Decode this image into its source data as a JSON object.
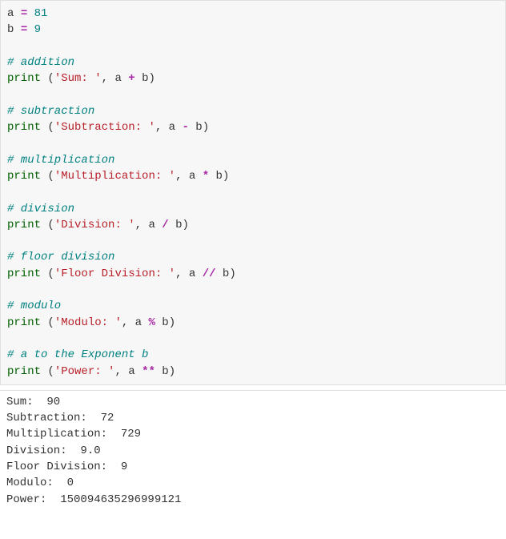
{
  "code": {
    "a_name": "a",
    "eq1": "=",
    "a_val": "81",
    "b_name": "b",
    "eq2": "=",
    "b_val": "9",
    "c_add": "# addition",
    "print1": "print",
    "lp1": "(",
    "s1": "'Sum: '",
    "cm1": ",",
    "a1": "a",
    "op1": "+",
    "b1": "b",
    "rp1": ")",
    "c_sub": "# subtraction",
    "print2": "print",
    "lp2": "(",
    "s2": "'Subtraction: '",
    "cm2": ",",
    "a2": "a",
    "op2": "-",
    "b2": "b",
    "rp2": ")",
    "c_mul": "# multiplication",
    "print3": "print",
    "lp3": "(",
    "s3": "'Multiplication: '",
    "cm3": ",",
    "a3": "a",
    "op3": "*",
    "b3": "b",
    "rp3": ")",
    "c_div": "# division",
    "print4": "print",
    "lp4": "(",
    "s4": "'Division: '",
    "cm4": ",",
    "a4": "a",
    "op4": "/",
    "b4": "b",
    "rp4": ")",
    "c_fdiv": "# floor division",
    "print5": "print",
    "lp5": "(",
    "s5": "'Floor Division: '",
    "cm5": ",",
    "a5": "a",
    "op5": "//",
    "b5": "b",
    "rp5": ")",
    "c_mod": "# modulo",
    "print6": "print",
    "lp6": "(",
    "s6": "'Modulo: '",
    "cm6": ",",
    "a6": "a",
    "op6": "%",
    "b6": "b",
    "rp6": ")",
    "c_pow": "# a to the Exponent b",
    "print7": "print",
    "lp7": "(",
    "s7": "'Power: '",
    "cm7": ",",
    "a7": "a",
    "op7": "**",
    "b7": "b",
    "rp7": ")"
  },
  "output": {
    "l1": "Sum:  90",
    "l2": "Subtraction:  72",
    "l3": "Multiplication:  729",
    "l4": "Division:  9.0",
    "l5": "Floor Division:  9",
    "l6": "Modulo:  0",
    "l7": "Power:  150094635296999121"
  }
}
